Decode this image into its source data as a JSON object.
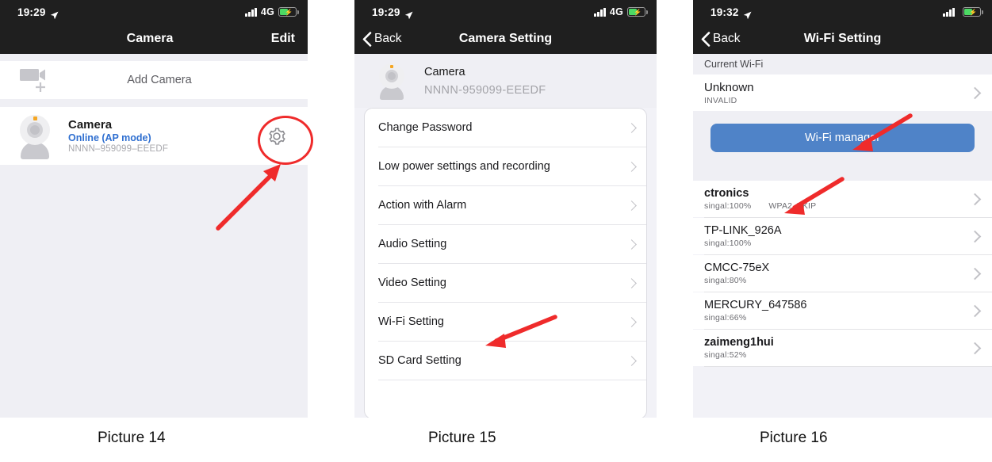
{
  "figure": {
    "captions": [
      {
        "id": "cap1",
        "label": "Picture 14"
      },
      {
        "id": "cap2",
        "label": "Picture 15"
      },
      {
        "id": "cap3",
        "label": "Picture 16"
      }
    ]
  },
  "colors": {
    "accent_blue": "#2f6fd0",
    "button_blue": "#4f83c8",
    "annotation_red": "#ef2b2b",
    "statusbar_bg": "#1f1f1f",
    "list_bg": "#efeff4",
    "battery_green": "#4cd964"
  },
  "panel1": {
    "status": {
      "time": "19:29",
      "network": "4G",
      "location_icon": "location-arrow-icon",
      "signal_icon": "signal-bars-icon",
      "battery_icon": "battery-charging-icon"
    },
    "nav": {
      "title": "Camera",
      "right_action": "Edit"
    },
    "add_camera": {
      "label": "Add Camera",
      "icon": "add-camera-icon"
    },
    "device": {
      "name": "Camera",
      "status": "Online (AP mode)",
      "uid": "NNNN–959099–EEEDF",
      "thumb_icon": "webcam-icon",
      "settings_icon": "gear-icon"
    }
  },
  "panel2": {
    "status": {
      "time": "19:29",
      "network": "4G",
      "location_icon": "location-arrow-icon",
      "signal_icon": "signal-bars-icon",
      "battery_icon": "battery-charging-icon"
    },
    "nav": {
      "back": "Back",
      "title": "Camera Setting"
    },
    "header": {
      "name": "Camera",
      "uid": "NNNN-959099-EEEDF",
      "thumb_icon": "webcam-icon"
    },
    "menu": [
      {
        "label": "Change Password"
      },
      {
        "label": "Low power settings and recording"
      },
      {
        "label": "Action with Alarm"
      },
      {
        "label": "Audio Setting"
      },
      {
        "label": "Video Setting"
      },
      {
        "label": "Wi-Fi Setting"
      },
      {
        "label": "SD Card Setting"
      }
    ]
  },
  "panel3": {
    "status": {
      "time": "19:32",
      "network": "",
      "location_icon": "location-arrow-icon",
      "signal_icon": "signal-bars-icon",
      "battery_icon": "battery-charging-icon"
    },
    "nav": {
      "back": "Back",
      "title": "Wi-Fi Setting"
    },
    "current_header": "Current Wi-Fi",
    "current": {
      "ssid": "Unknown",
      "security": "INVALID"
    },
    "manager_button": "Wi-Fi manager",
    "networks": [
      {
        "ssid": "ctronics",
        "signal": "singal:100%",
        "security": "WPA2_TKIP"
      },
      {
        "ssid": "TP-LINK_926A",
        "signal": "singal:100%",
        "security": ""
      },
      {
        "ssid": "CMCC-75eX",
        "signal": "singal:80%",
        "security": ""
      },
      {
        "ssid": "MERCURY_647586",
        "signal": "singal:66%",
        "security": ""
      },
      {
        "ssid": "zaimeng1hui",
        "signal": "singal:52%",
        "security": ""
      }
    ]
  }
}
